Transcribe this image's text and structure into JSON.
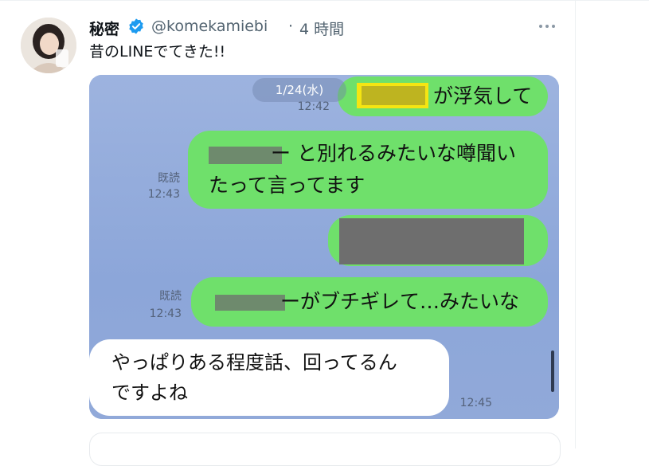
{
  "tweet": {
    "author_name": "秘密",
    "handle": "@komekamiebi",
    "separator": "·",
    "time": "4 時間",
    "text": "昔のLINEでてきた!!"
  },
  "line_chat": {
    "date_chip": "1/24(水)",
    "messages": [
      {
        "side": "right",
        "text": "が浮気して",
        "read_label": "",
        "time": "12:42"
      },
      {
        "side": "right",
        "text": "ー と別れるみたいな噂聞い",
        "text2": "たって言ってます",
        "read_label": "既読",
        "time": "12:43"
      },
      {
        "side": "right",
        "text": "",
        "read_label": "",
        "time": ""
      },
      {
        "side": "right",
        "text": "ーがブチギレて…みたいな",
        "read_label": "既読",
        "time": "12:43"
      },
      {
        "side": "left",
        "text": "やっぱりある程度話、回ってるん",
        "text2": "ですよね",
        "time": "12:45"
      }
    ]
  },
  "colors": {
    "line_background": "#8fa8d8",
    "bubble_green": "#6fe06b",
    "verified_blue": "#1d9bf0"
  },
  "icons": [
    "verified-badge-icon",
    "more-options-icon",
    "avatar-photo"
  ]
}
